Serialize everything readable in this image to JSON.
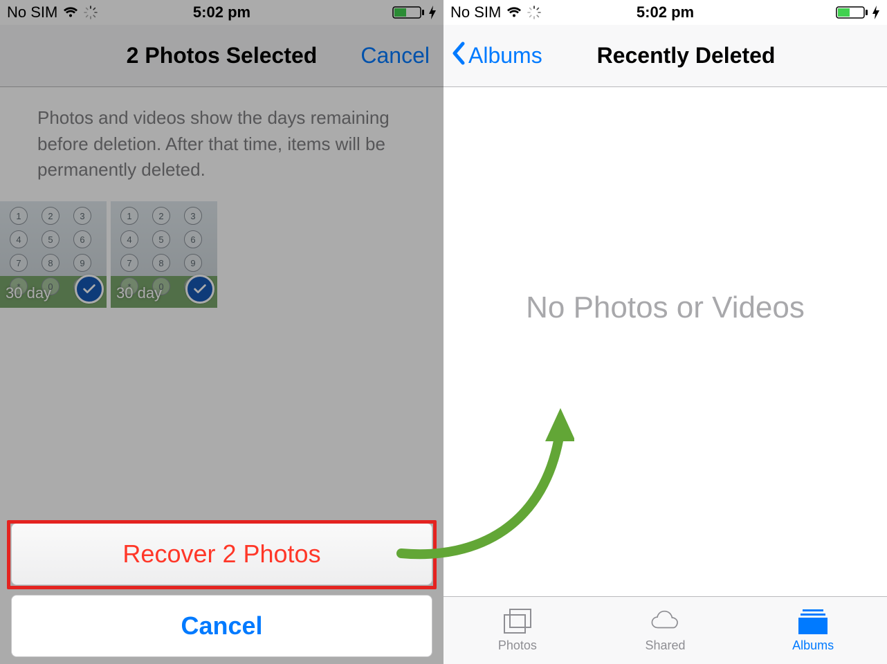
{
  "left": {
    "status": {
      "carrier": "No SIM",
      "time": "5:02 pm"
    },
    "nav": {
      "title": "2 Photos Selected",
      "cancel": "Cancel"
    },
    "description": "Photos and videos show the days remaining before deletion. After that time, items will be permanently deleted.",
    "thumbs": [
      {
        "days_label": "30 day",
        "keys": [
          "1",
          "2",
          "3",
          "4",
          "5",
          "6",
          "7",
          "8",
          "9",
          "*",
          "0",
          "#"
        ]
      },
      {
        "days_label": "30 day",
        "keys": [
          "1",
          "2",
          "3",
          "4",
          "5",
          "6",
          "7",
          "8",
          "9",
          "*",
          "0",
          "#"
        ]
      }
    ],
    "sheet": {
      "recover": "Recover 2 Photos",
      "cancel": "Cancel"
    }
  },
  "right": {
    "status": {
      "carrier": "No SIM",
      "time": "5:02 pm"
    },
    "nav": {
      "back": "Albums",
      "title": "Recently Deleted"
    },
    "empty_message": "No Photos or Videos",
    "tabs": {
      "photos": "Photos",
      "shared": "Shared",
      "albums": "Albums"
    }
  },
  "colors": {
    "accent": "#007aff",
    "destructive": "#ff3728",
    "green": "#5fa433"
  }
}
